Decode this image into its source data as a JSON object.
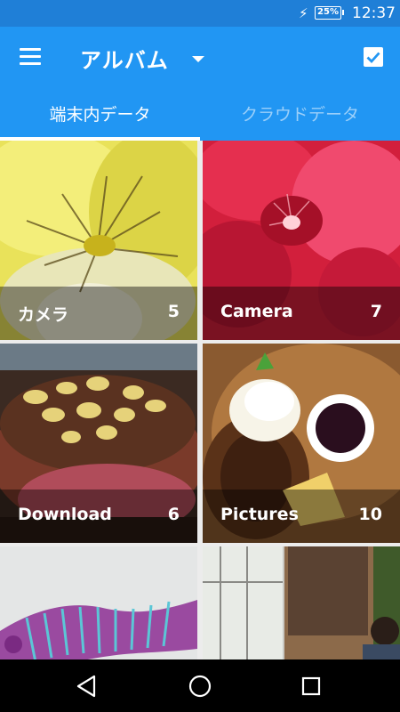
{
  "status_bar": {
    "battery": "25%",
    "time": "12:37"
  },
  "app_bar": {
    "title": "アルバム"
  },
  "tabs": [
    {
      "label": "端末内データ",
      "active": true
    },
    {
      "label": "クラウドデータ",
      "active": false
    }
  ],
  "albums": [
    {
      "name": "カメラ",
      "count": "5"
    },
    {
      "name": "Camera",
      "count": "7"
    },
    {
      "name": "Download",
      "count": "6"
    },
    {
      "name": "Pictures",
      "count": "10"
    }
  ],
  "colors": {
    "primary": "#2196f3",
    "primary_dark": "#1f7fd7"
  },
  "icons": {
    "menu": "menu-icon",
    "dropdown": "dropdown-caret-icon",
    "select": "checkbox-icon",
    "back": "back-icon",
    "home": "home-icon",
    "recents": "recents-icon"
  }
}
